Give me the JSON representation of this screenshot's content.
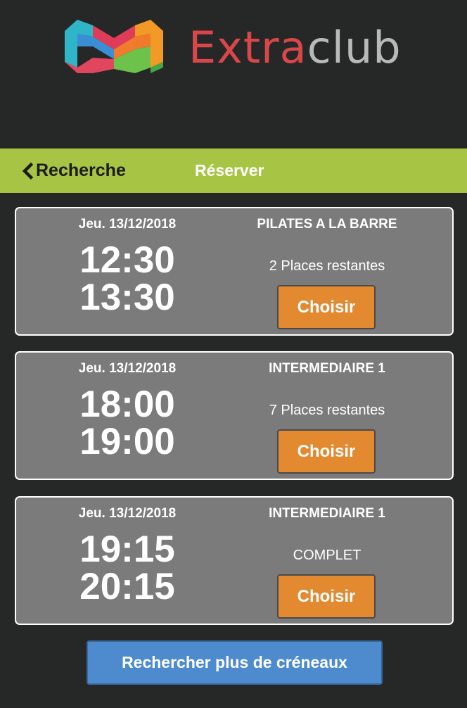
{
  "header": {
    "logo_text_part1": "Extra",
    "logo_text_part2": "club",
    "logo_colors": {
      "text_red": "#d9474a",
      "text_gray": "#b9b9b9"
    }
  },
  "navbar": {
    "back_label": "Recherche",
    "title": "Réserver",
    "background": "#a7c444"
  },
  "slots": [
    {
      "date": "Jeu. 13/12/2018",
      "start": "12:30",
      "end": "13:30",
      "course": "PILATES A LA BARRE",
      "places": "2 Places restantes",
      "button_label": "Choisir"
    },
    {
      "date": "Jeu. 13/12/2018",
      "start": "18:00",
      "end": "19:00",
      "course": "INTERMEDIAIRE 1",
      "places": "7 Places restantes",
      "button_label": "Choisir"
    },
    {
      "date": "Jeu. 13/12/2018",
      "start": "19:15",
      "end": "20:15",
      "course": "INTERMEDIAIRE 1",
      "places": "COMPLET",
      "button_label": "Choisir"
    }
  ],
  "more_button_label": "Rechercher plus de créneaux",
  "colors": {
    "page_background": "#262727",
    "card_background": "#7b7b7b",
    "choose_button": "#e38a31",
    "more_button": "#4d8bce"
  }
}
